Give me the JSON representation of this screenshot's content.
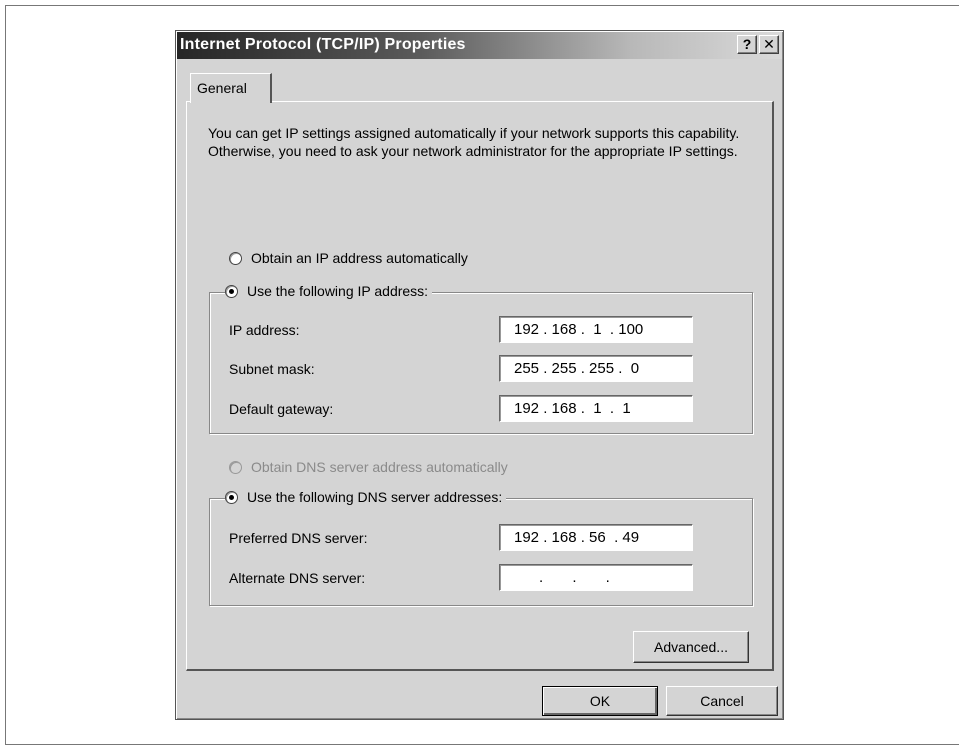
{
  "dialog": {
    "title": "Internet Protocol (TCP/IP) Properties",
    "help_label": "?",
    "close_label": "✕"
  },
  "tabs": [
    {
      "label": "General",
      "selected": true
    }
  ],
  "intro_text": "You can get IP settings assigned automatically if your network supports this capability. Otherwise, you need to ask your network administrator for the appropriate IP settings.",
  "ip_mode": {
    "auto_label": "Obtain an IP address automatically",
    "manual_label": "Use the following IP address:",
    "selected": "manual"
  },
  "ip_fields": [
    {
      "label": "IP address:",
      "value": "192 . 168 .  1  . 100"
    },
    {
      "label": "Subnet mask:",
      "value": "255 . 255 . 255 .  0"
    },
    {
      "label": "Default gateway:",
      "value": "192 . 168 .  1  .  1"
    }
  ],
  "dns_mode": {
    "auto_label": "Obtain DNS server address automatically",
    "auto_disabled": true,
    "manual_label": "Use the following DNS server addresses:",
    "selected": "manual"
  },
  "dns_fields": [
    {
      "label": "Preferred DNS server:",
      "value": "192 . 168 . 56  . 49"
    },
    {
      "label": "Alternate DNS server:",
      "value": "      .       .       ."
    }
  ],
  "buttons": {
    "advanced": "Advanced...",
    "ok": "OK",
    "cancel": "Cancel"
  },
  "colors": {
    "face": "#d4d4d4",
    "titlebar_start": "#262626",
    "titlebar_end": "#dadada",
    "disabled_text": "#8a8a8a"
  }
}
